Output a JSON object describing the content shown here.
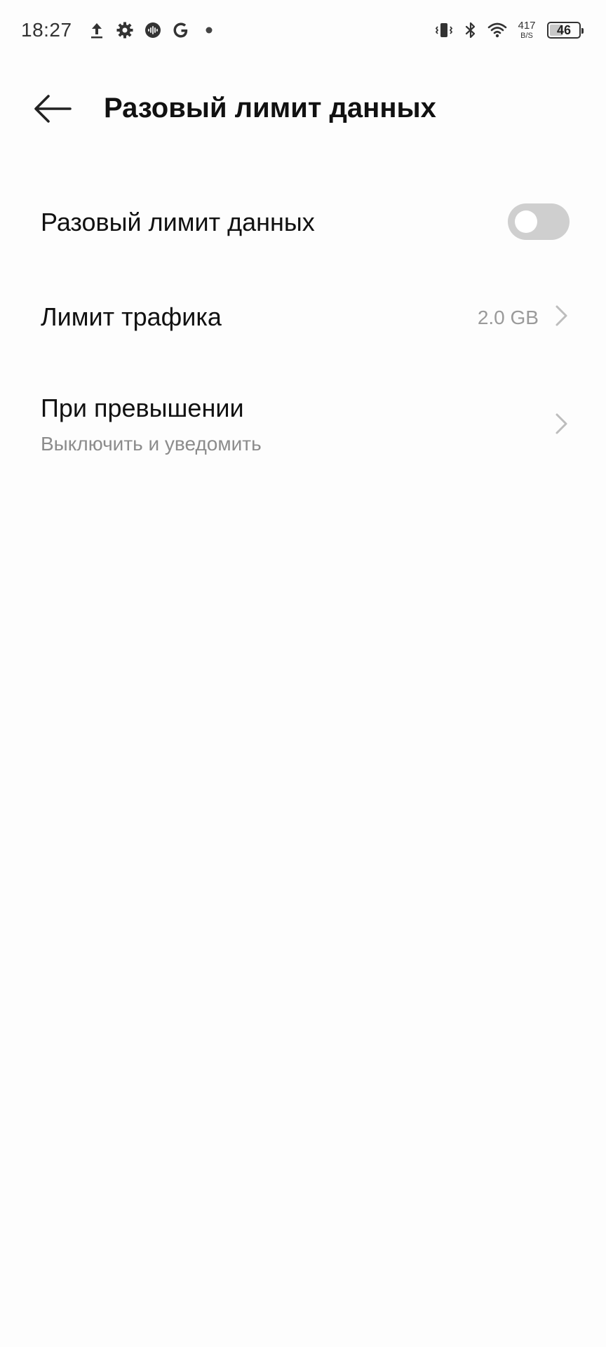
{
  "status_bar": {
    "time": "18:27",
    "left_icons": [
      "upload-icon",
      "gear-icon",
      "podcast-icon",
      "google-icon",
      "dot-icon"
    ],
    "right_icons": [
      "vibrate-icon",
      "bluetooth-icon",
      "wifi-icon"
    ],
    "net_speed_value": "417",
    "net_speed_unit": "B/S",
    "battery_level": "46",
    "battery_fraction": 0.46
  },
  "header": {
    "back_icon": "arrow-left-icon",
    "title": "Разовый лимит данных"
  },
  "settings": {
    "toggle_row": {
      "label": "Разовый лимит данных",
      "enabled": false
    },
    "limit_row": {
      "label": "Лимит трафика",
      "value": "2.0 GB",
      "icon": "chevron-right-icon"
    },
    "exceed_row": {
      "label": "При превышении",
      "subtitle": "Выключить и уведомить",
      "icon": "chevron-right-icon"
    }
  },
  "colors": {
    "background": "#fdfdfd",
    "text_primary": "#111111",
    "text_secondary": "#8c8c8c",
    "toggle_off": "#cfcfcf"
  }
}
